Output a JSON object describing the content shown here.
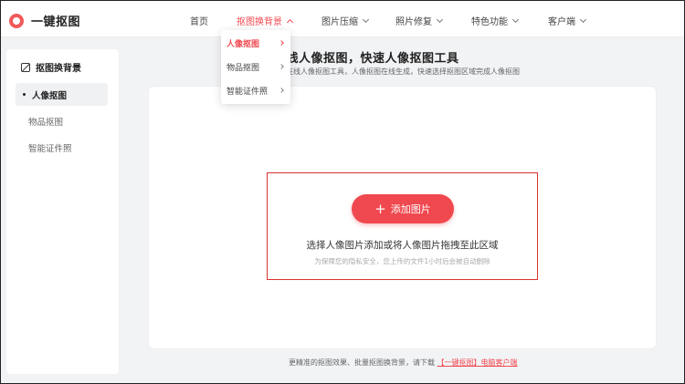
{
  "brand": {
    "name": "一键抠图",
    "icon": "logo-icon",
    "accent": "#f0484f"
  },
  "nav": {
    "items": [
      {
        "label": "首页",
        "has_menu": false,
        "active": false
      },
      {
        "label": "抠图换背景",
        "has_menu": true,
        "active": true
      },
      {
        "label": "图片压缩",
        "has_menu": true,
        "active": false
      },
      {
        "label": "照片修复",
        "has_menu": true,
        "active": false
      },
      {
        "label": "特色功能",
        "has_menu": true,
        "active": false
      },
      {
        "label": "客户端",
        "has_menu": true,
        "active": false
      }
    ]
  },
  "dropdown": {
    "items": [
      {
        "label": "人像抠图",
        "active": true
      },
      {
        "label": "物品抠图",
        "active": false
      },
      {
        "label": "智能证件照",
        "active": false
      }
    ]
  },
  "sidebar": {
    "title": "抠图换背景",
    "items": [
      {
        "label": "人像抠图",
        "active": true
      },
      {
        "label": "物品抠图",
        "active": false
      },
      {
        "label": "智能证件照",
        "active": false
      }
    ]
  },
  "main": {
    "title": "在线人像抠图，快速人像抠图工具",
    "subtitle": "在线人像抠图工具，人像抠图在线生成，快速选择抠图区域完成人像抠图",
    "upload_button": "添加图片",
    "drop_text": "选择人像图片添加或将人像图片拖拽至此区域",
    "privacy_note": "为保障您的隐私安全，您上传的文件1小时后会被自动删除"
  },
  "footer": {
    "text": "更精准的抠图效果、批量抠图换背景，请下载",
    "link": "【一键抠图】电脑客户端"
  }
}
